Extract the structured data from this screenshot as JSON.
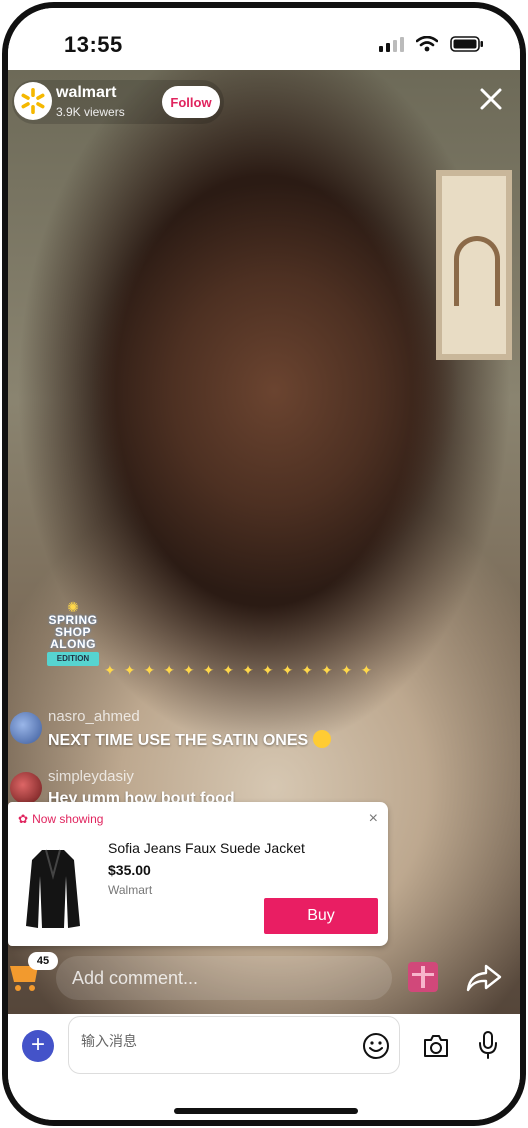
{
  "status_bar": {
    "time": "13:55"
  },
  "host": {
    "name": "walmart",
    "viewers": "3.9K viewers",
    "follow_label": "Follow"
  },
  "promo": {
    "line1": "SPRING",
    "line2": "SHOP",
    "line3": "ALONG",
    "badge": "EDITION"
  },
  "comments": [
    {
      "user": "nasro_ahmed",
      "message": "NEXT TIME USE THE SATIN ONES"
    },
    {
      "user": "simpleydasiy",
      "message": "Hey umm how bout food"
    }
  ],
  "product_card": {
    "header": "Now showing",
    "close": "×",
    "name": "Sofia Jeans Faux Suede Jacket",
    "price": "$35.00",
    "seller": "Walmart",
    "buy_label": "Buy"
  },
  "bottom_bar": {
    "cart_count": "45",
    "comment_placeholder": "Add comment..."
  },
  "keyboard_bar": {
    "input_placeholder": "输入消息"
  },
  "colors": {
    "accent": "#e91e63",
    "follow_text": "#e0245e",
    "plus_button": "#4453c9"
  },
  "icons": [
    "walmart-spark-icon",
    "close-icon",
    "cart-icon",
    "gift-icon",
    "share-icon",
    "plus-icon",
    "emoji-icon",
    "camera-icon",
    "mic-icon",
    "wifi-icon",
    "battery-icon",
    "signal-icon"
  ]
}
